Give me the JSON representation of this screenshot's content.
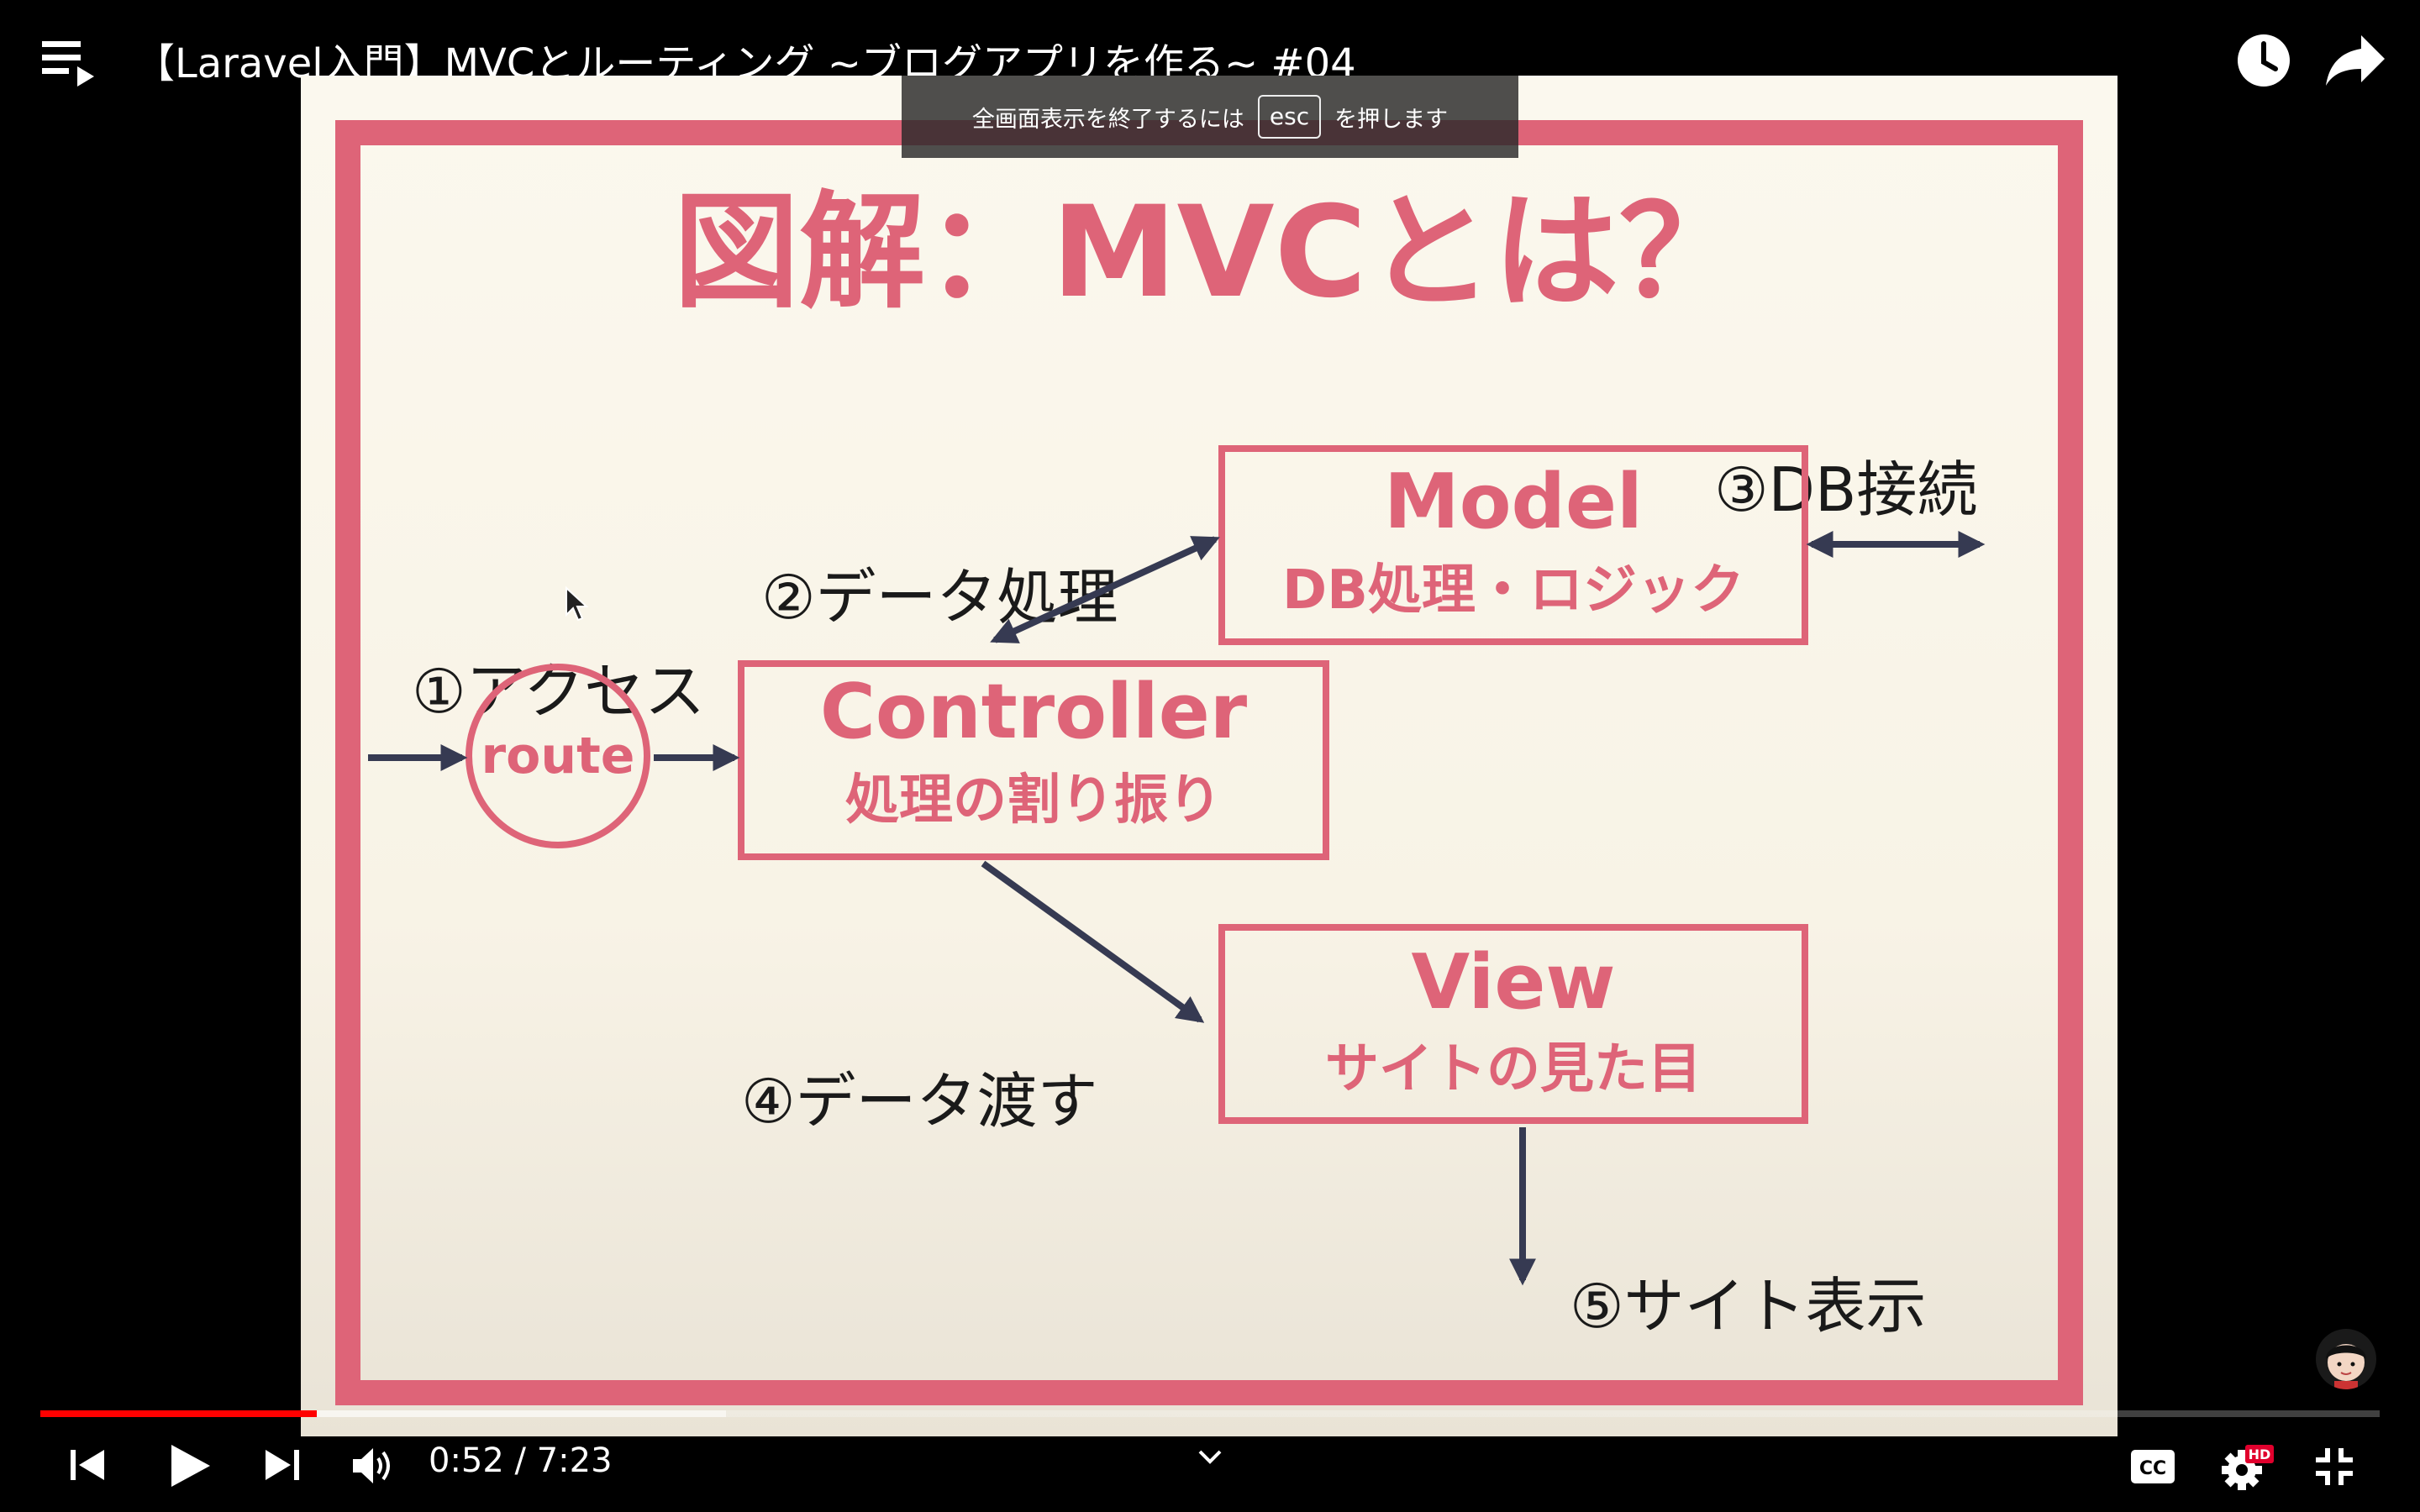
{
  "player": {
    "title": "【Laravel入門】MVCとルーティング ~ブログアプリを作る~ #04",
    "esc_notice_before": "全画面表示を終了するには",
    "esc_key": "esc",
    "esc_notice_after": "を押します",
    "time": {
      "current": "0:52",
      "separator": " / ",
      "duration": "7:23"
    },
    "progress": {
      "played_fraction": 0.118,
      "buffered_fraction": 0.293
    },
    "settings_badge": "HD",
    "cc_label": "CC"
  },
  "slide": {
    "title": "図解：MVCとは？",
    "step1": "①アクセス",
    "step2": "②データ処理",
    "step3": "③DB接続",
    "step4": "④データ渡す",
    "step5": "⑤サイト表示",
    "route_label": "route",
    "controller": {
      "title": "Controller",
      "subtitle": "処理の割り振り"
    },
    "model": {
      "title": "Model",
      "subtitle": "DB処理・ロジック"
    },
    "view": {
      "title": "View",
      "subtitle": "サイトの見た目"
    },
    "colors": {
      "accent": "#de6478",
      "arrow": "#363a52",
      "background": "#f4efe2"
    }
  }
}
